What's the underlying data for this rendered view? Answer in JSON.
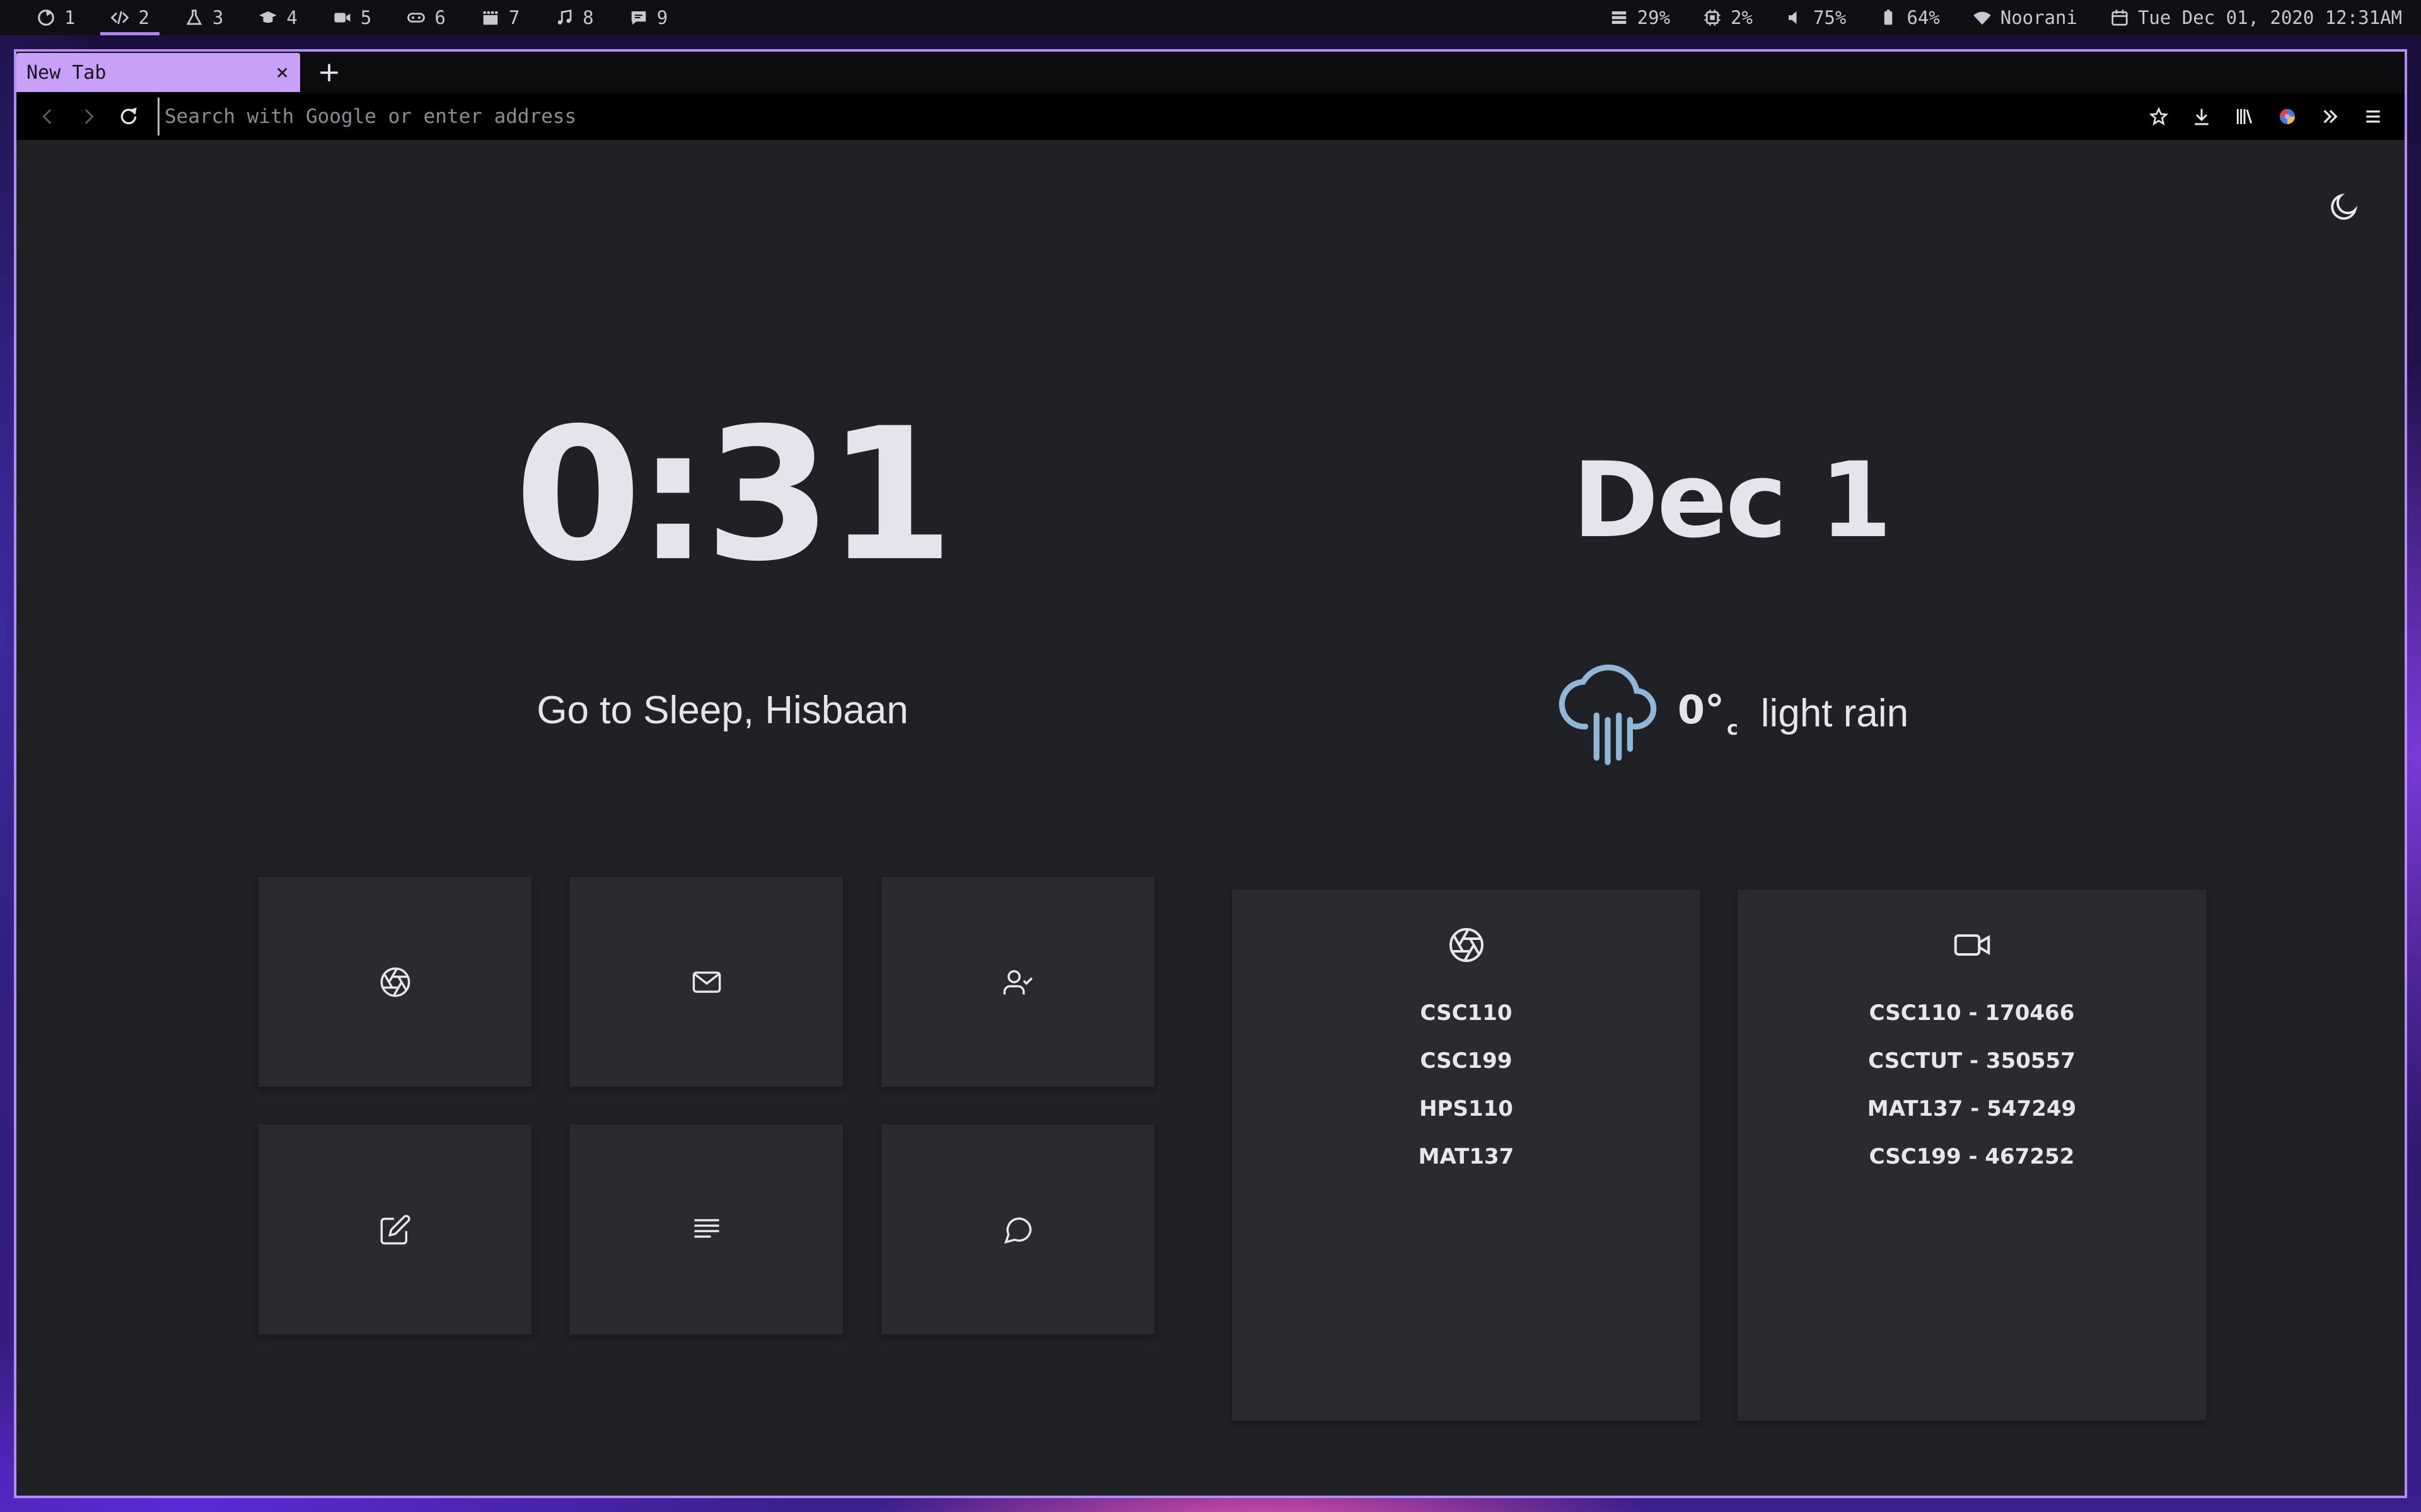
{
  "system_bar": {
    "workspaces": [
      {
        "num": "1",
        "icon": "firefox-icon"
      },
      {
        "num": "2",
        "icon": "code-icon",
        "active": true
      },
      {
        "num": "3",
        "icon": "flask-icon"
      },
      {
        "num": "4",
        "icon": "graduation-cap-icon"
      },
      {
        "num": "5",
        "icon": "video-camera-icon"
      },
      {
        "num": "6",
        "icon": "gamepad-icon"
      },
      {
        "num": "7",
        "icon": "film-icon"
      },
      {
        "num": "8",
        "icon": "music-icon"
      },
      {
        "num": "9",
        "icon": "chat-icon"
      }
    ],
    "memory": "29%",
    "cpu": "2%",
    "volume": "75%",
    "battery": "64%",
    "wifi": "Noorani",
    "datetime": "Tue Dec 01, 2020 12:31AM"
  },
  "browser": {
    "tab_title": "New Tab",
    "tab_close": "×",
    "new_tab": "+",
    "url_placeholder": "Search with Google or enter address"
  },
  "page": {
    "clock": "0:31",
    "greeting": "Go to Sleep, Hisbaan",
    "date": "Dec 1",
    "temperature": "0°",
    "temperature_unit": "c",
    "condition": "light rain"
  },
  "tiles": [
    {
      "icon": "aperture-icon"
    },
    {
      "icon": "mail-icon"
    },
    {
      "icon": "user-check-icon"
    },
    {
      "icon": "edit-icon"
    },
    {
      "icon": "text-lines-icon"
    },
    {
      "icon": "message-circle-icon"
    }
  ],
  "cards": [
    {
      "icon": "aperture-icon",
      "links": [
        "CSC110",
        "CSC199",
        "HPS110",
        "MAT137"
      ]
    },
    {
      "icon": "video-icon",
      "links": [
        "CSC110 - 170466",
        "CSCTUT - 350557",
        "MAT137 - 547249",
        "CSC199 - 467252"
      ]
    }
  ],
  "colors": {
    "accent": "#c7a0f8",
    "page_bg": "#202124",
    "tile_bg": "#2a2b2e",
    "weather_icon": "#8fb8d8"
  }
}
